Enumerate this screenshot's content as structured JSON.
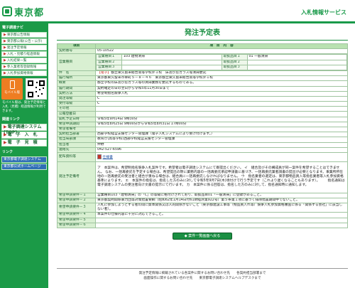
{
  "header": {
    "logo_text": "東京都",
    "system_title": "入札情報サービス"
  },
  "sidebar": {
    "section_title": "電子調達ナビ",
    "menu_items": [
      "東京都公告情報",
      "東京都公報(公告・公示)",
      "発注予定情報",
      "入札・見積り経過情報",
      "入札結果一覧",
      "参入業者等登録情報",
      "入札参加資格情報"
    ],
    "mobile_badge": "モバイル版",
    "mobile_note": "モバイル版は、発注予定情報と入札（見積）経過情報が利用できます。",
    "mobile_links_title": "関連リンク",
    "buttons": [
      "電子調達システム(TOP)",
      "電　子　入　札",
      "電　子　見　積"
    ],
    "links_title": "リンク",
    "links": [
      "東京都電子調達システム",
      "東京都公式ホームページ"
    ]
  },
  "main": {
    "title": "発注予定表",
    "header_item": "項目",
    "header_content": "項　目　内　容",
    "rows": [
      {
        "label": "契約番号",
        "value": "05-10522"
      },
      {
        "label": "営業種目",
        "value": ""
      },
      {
        "label": "件　名",
        "tag": "【電子】",
        "value": "都立東久留米総合高等学校外１校　床及び窓ガラス等清掃委託"
      },
      {
        "label": "履行場所",
        "value": "東京都東久留米市幸町５－８－４６　東京都立東久留米総合高等学校外１校"
      },
      {
        "label": "概要",
        "value": "都立学校の床及び窓ガラス等の清掃業務を委託するものである。"
      },
      {
        "label": "履行期間",
        "value": "契約確定の日の翌日から令和5年11月30日まで"
      },
      {
        "label": "契約方法",
        "value": "希望制指名競争入札"
      },
      {
        "label": "発注等級",
        "value": "C"
      },
      {
        "label": "受付等級",
        "value": "C"
      },
      {
        "label": "その他",
        "value": ""
      },
      {
        "label": "公報登載日",
        "value": ""
      },
      {
        "label": "開札予定日時",
        "value": "令和5年9月14日 9時30分"
      },
      {
        "label": "希望申請期間",
        "value": "令和5年8月25日 9時00分から令和5年8月31日 17時00分"
      },
      {
        "label": "希望者備考",
        "value": ""
      },
      {
        "label": "契約担当部署",
        "value": "西部学校経営支援センター管理課（電子入札システムにより受け付けます。）"
      },
      {
        "label": "担当局部課",
        "value": "教育庁(高等学校)西部学校経営支援センター管理課"
      },
      {
        "label": "担当者",
        "value": "仲野"
      },
      {
        "label": "連絡先",
        "value": "042-527-6596"
      },
      {
        "label": "配布資料等",
        "value": "仕様書"
      },
      {
        "label": "発注予定備考",
        "value": "ア　本案件は、希望制指名競争入札案件です。希望者は電子調達システムにて御提出ください。\nイ　組合及びその構成員が同一案件を希望することはできません。\nなお、一括再委託を予定する場合は、希望提出の際に業務内容の一括再委託承認申請書に基づき、一括再委託業者調書の提出が必要となります。事業所所在地の一括再委託の受注者と組合が重ねる場合は、組合員に一括再委託しなければなりません。\nウ　指名業者の選定は、東京都物品買入等指名業者等入札参加資格基準によります。\nエ　本案件の指名は、指名した方のみに対して令和5年9月7日(木)頃付けで行う予定です（これより遅くなることもあります）。\n　　指名通知は電子調達システムの受注者向け文書の提示にて行います。\nカ　本案件に係る回答は、指名した方のみに対して、指名通知時に通知します。"
      },
      {
        "label": "希望申請要件－１",
        "value": "営業種目103「建物清掃」の「C」の等級に格付けされており、取扱品目01「一般清掃」に登録があること。"
      },
      {
        "label": "希望申請要件－２",
        "value": "東京都契約関係暴力団等対策措置要綱（昭和62年1月14日付61財経庶第922号）第５条第１項に基づく排除措置期間中でないこと。"
      },
      {
        "label": "希望申請要件－３",
        "value": "入札に参加しようとする者の間に資本関係又は人的関係がないこと（東京都建設工事等（物品買入れ等）競争入札参加資格審査に係る「関係する会社」に該当しない者）。"
      },
      {
        "label": "希望申請要件－４",
        "value": "本案件の仕様内容に十分に対応できること。"
      },
      {
        "label": "希望申請要件－５",
        "value": ""
      },
      {
        "label": "希望申請要件－６",
        "value": ""
      }
    ],
    "business_types": [
      {
        "label": "営業種目１",
        "value": "103 建物清掃",
        "item_label": "取扱品目１",
        "item_value": "01 一般清掃"
      },
      {
        "label": "営業種目２",
        "value": "",
        "item_label": "取扱品目２",
        "item_value": ""
      },
      {
        "label": "営業種目３",
        "value": "",
        "item_label": "取扱品目３",
        "item_value": ""
      }
    ],
    "back_button": "案件一覧画面へ戻る"
  },
  "footer": {
    "line1": "発注予定情報に掲載されている各案件に関するお問い合わせ先　　各契約担当部署まで",
    "line2": "画面操作に関するお問い合わせ先　　東京都電子調達システムヘルプデスクまで"
  }
}
